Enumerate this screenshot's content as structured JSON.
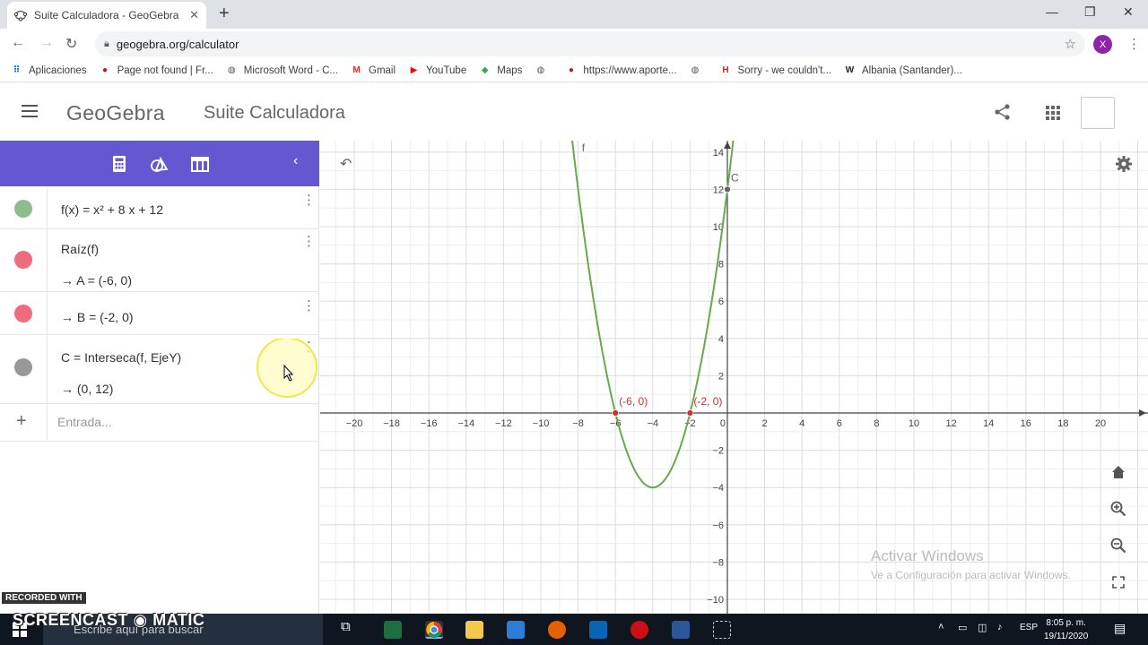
{
  "browser": {
    "tab_title": "Suite Calculadora - GeoGebra",
    "tab_close": "✕",
    "new_tab": "+",
    "win_minimize": "—",
    "win_restore": "❐",
    "win_close": "✕",
    "url": "geogebra.org/calculator",
    "profile_initial": "X",
    "bookmarks": [
      {
        "label": "Aplicaciones",
        "icon": "apps-grid-icon"
      },
      {
        "label": "Page not found | Fr...",
        "icon": "site-icon"
      },
      {
        "label": "Microsoft Word - C...",
        "icon": "globe-icon"
      },
      {
        "label": "Gmail",
        "icon": "gmail-icon"
      },
      {
        "label": "YouTube",
        "icon": "youtube-icon"
      },
      {
        "label": "Maps",
        "icon": "maps-icon"
      },
      {
        "label": "",
        "icon": "globe-icon"
      },
      {
        "label": "https://www.aporte...",
        "icon": "site-icon"
      },
      {
        "label": "",
        "icon": "globe-icon"
      },
      {
        "label": "Sorry - we couldn't...",
        "icon": "h-icon"
      },
      {
        "label": "Albania (Santander)...",
        "icon": "wikipedia-icon"
      }
    ]
  },
  "app": {
    "logo": "GeoGebra",
    "title": "Suite Calculadora",
    "accent": "#6557d2"
  },
  "algebra": {
    "rows": [
      {
        "lines": [
          "f(x) = x² + 8 x + 12"
        ],
        "color": "#8fbc8f"
      },
      {
        "lines": [
          "Raíz(f)",
          "→  A = (-6, 0)"
        ],
        "color": "#f06b7c"
      },
      {
        "lines": [
          "→  B = (-2, 0)"
        ],
        "color": "#f06b7c"
      },
      {
        "lines": [
          "C = Interseca(f, EjeY)",
          "→  (0, 12)"
        ],
        "color": "#999999"
      }
    ],
    "input_placeholder": "Entrada..."
  },
  "graph": {
    "x_ticks": [
      -20,
      -18,
      -16,
      -14,
      -12,
      -10,
      -8,
      -6,
      -4,
      -2,
      0,
      2,
      4,
      6,
      8,
      10,
      12,
      14,
      16,
      18,
      20
    ],
    "y_ticks": [
      -10,
      -8,
      -6,
      -4,
      -2,
      2,
      4,
      6,
      8,
      10,
      12,
      14
    ],
    "function_label": "f",
    "points": [
      {
        "name": "A",
        "x": -6,
        "y": 0,
        "label": "(-6, 0)",
        "color": "#d32f2f"
      },
      {
        "name": "B",
        "x": -2,
        "y": 0,
        "label": "(-2, 0)",
        "color": "#d32f2f"
      },
      {
        "name": "C",
        "x": 0,
        "y": 12,
        "label": "C",
        "color": "#666666"
      }
    ],
    "curve_color": "#6aa84f"
  },
  "watermark": {
    "line1": "Activar Windows",
    "line2": "Ve a Configuración para activar Windows."
  },
  "taskbar": {
    "search_placeholder": "Escribe aquí para buscar",
    "lang": "ESP",
    "time": "8:05 p. m.",
    "date": "19/11/2020"
  },
  "overlay": {
    "recorded": "RECORDED WITH",
    "brand": "SCREENCAST ◉ MATIC"
  }
}
